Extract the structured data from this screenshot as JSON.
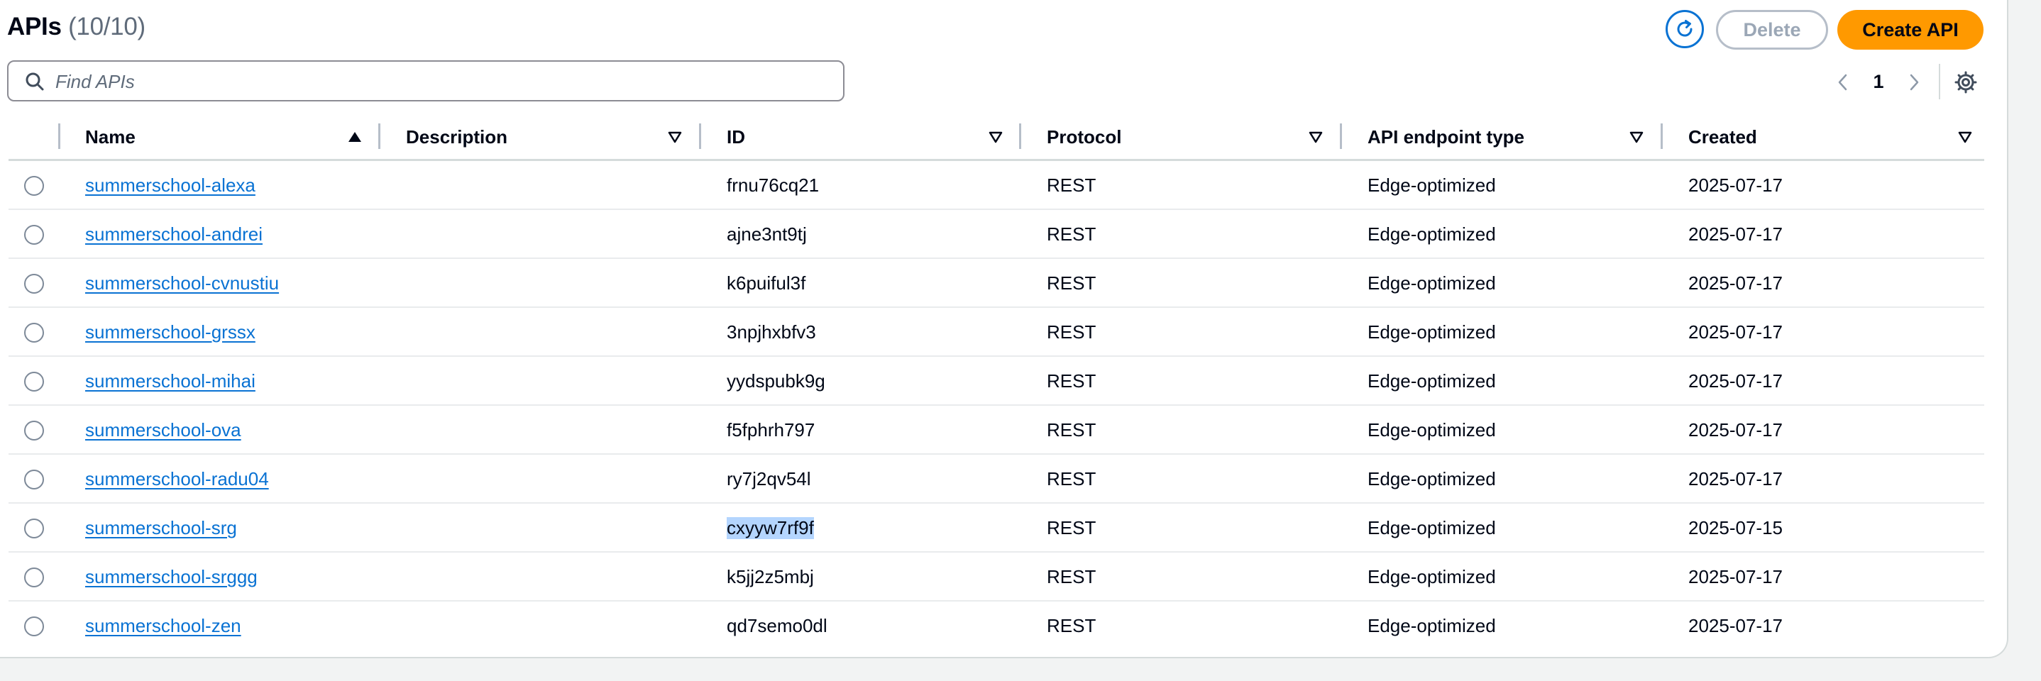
{
  "header": {
    "title": "APIs",
    "count": "(10/10)",
    "refresh_icon": "refresh-icon",
    "delete_label": "Delete",
    "create_label": "Create API"
  },
  "search": {
    "placeholder": "Find APIs",
    "value": ""
  },
  "pagination": {
    "current_page": "1",
    "prev_icon": "chevron-left-icon",
    "next_icon": "chevron-right-icon",
    "settings_icon": "gear-icon"
  },
  "colors": {
    "link": "#0972d3",
    "primary_button": "#ff9900",
    "selection_highlight": "#b4d5fe"
  },
  "table": {
    "columns": [
      "Name",
      "Description",
      "ID",
      "Protocol",
      "API endpoint type",
      "Created"
    ],
    "sort": {
      "column": "Name",
      "direction": "ascending"
    },
    "rows": [
      {
        "name": "summerschool-alexa",
        "description": "",
        "id": "frnu76cq21",
        "protocol": "REST",
        "endpoint": "Edge-optimized",
        "created": "2025-07-17"
      },
      {
        "name": "summerschool-andrei",
        "description": "",
        "id": "ajne3nt9tj",
        "protocol": "REST",
        "endpoint": "Edge-optimized",
        "created": "2025-07-17"
      },
      {
        "name": "summerschool-cvnustiu",
        "description": "",
        "id": "k6puiful3f",
        "protocol": "REST",
        "endpoint": "Edge-optimized",
        "created": "2025-07-17"
      },
      {
        "name": "summerschool-grssx",
        "description": "",
        "id": "3npjhxbfv3",
        "protocol": "REST",
        "endpoint": "Edge-optimized",
        "created": "2025-07-17"
      },
      {
        "name": "summerschool-mihai",
        "description": "",
        "id": "yydspubk9g",
        "protocol": "REST",
        "endpoint": "Edge-optimized",
        "created": "2025-07-17"
      },
      {
        "name": "summerschool-ova",
        "description": "",
        "id": "f5fphrh797",
        "protocol": "REST",
        "endpoint": "Edge-optimized",
        "created": "2025-07-17"
      },
      {
        "name": "summerschool-radu04",
        "description": "",
        "id": "ry7j2qv54l",
        "protocol": "REST",
        "endpoint": "Edge-optimized",
        "created": "2025-07-17"
      },
      {
        "name": "summerschool-srg",
        "description": "",
        "id": "cxyyw7rf9f",
        "protocol": "REST",
        "endpoint": "Edge-optimized",
        "created": "2025-07-15",
        "id_selected": true
      },
      {
        "name": "summerschool-srggg",
        "description": "",
        "id": "k5jj2z5mbj",
        "protocol": "REST",
        "endpoint": "Edge-optimized",
        "created": "2025-07-17"
      },
      {
        "name": "summerschool-zen",
        "description": "",
        "id": "qd7semo0dl",
        "protocol": "REST",
        "endpoint": "Edge-optimized",
        "created": "2025-07-17"
      }
    ]
  }
}
